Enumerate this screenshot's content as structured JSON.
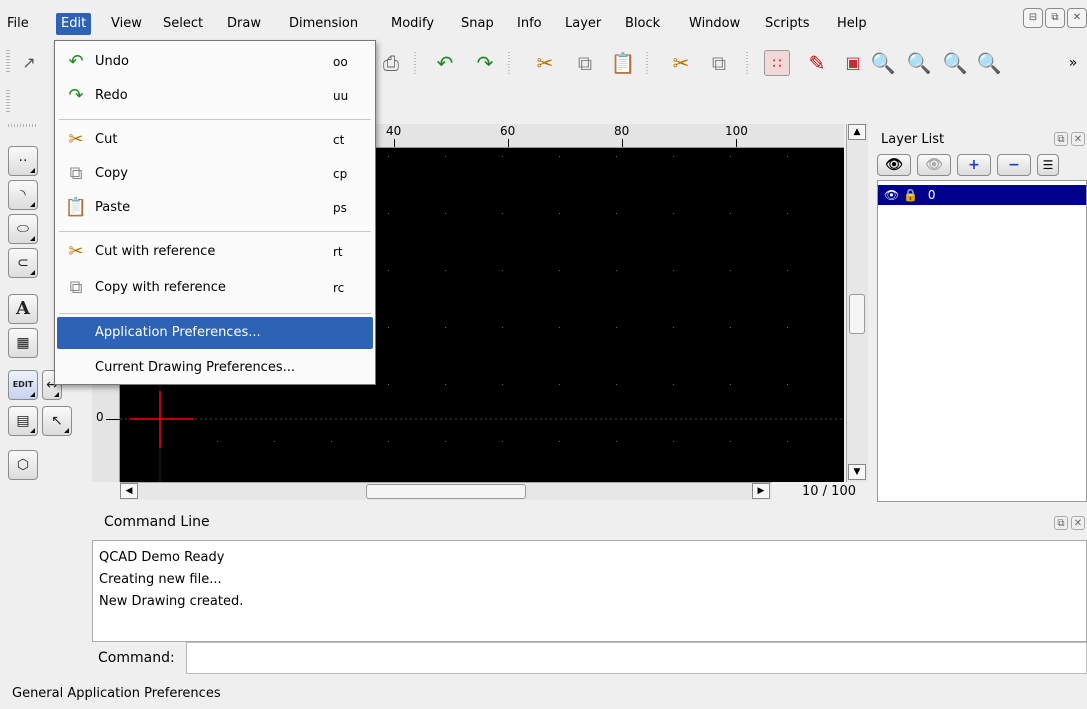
{
  "menubar": {
    "items": [
      "File",
      "Edit",
      "View",
      "Select",
      "Draw",
      "Dimension",
      "Modify",
      "Snap",
      "Info",
      "Layer",
      "Block",
      "Window",
      "Scripts",
      "Help"
    ],
    "active": "Edit"
  },
  "edit_menu": {
    "items": [
      {
        "label": "Undo",
        "shortcut": "oo",
        "icon": "undo-arrow-icon"
      },
      {
        "label": "Redo",
        "shortcut": "uu",
        "icon": "redo-arrow-icon"
      },
      {
        "label": "Cut",
        "shortcut": "ct",
        "icon": "scissors-icon"
      },
      {
        "label": "Copy",
        "shortcut": "cp",
        "icon": "copy-icon"
      },
      {
        "label": "Paste",
        "shortcut": "ps",
        "icon": "paste-icon"
      },
      {
        "label": "Cut with reference",
        "shortcut": "rt",
        "icon": "cut-with-reference-icon"
      },
      {
        "label": "Copy with reference",
        "shortcut": "rc",
        "icon": "copy-with-reference-icon"
      },
      {
        "label": "Application Preferences...",
        "shortcut": "",
        "icon": ""
      },
      {
        "label": "Current Drawing Preferences...",
        "shortcut": "",
        "icon": ""
      }
    ],
    "highlighted": "Application Preferences..."
  },
  "ruler": {
    "h_ticks": [
      "40",
      "60",
      "80",
      "100"
    ],
    "v_ticks": [
      "0"
    ]
  },
  "drawing": {
    "zoom_status": "10 / 100",
    "background": "#000000",
    "crosshair_color": "#ff0000"
  },
  "layer_panel": {
    "title": "Layer List",
    "layers": [
      {
        "name": "0",
        "visible": true,
        "locked": true
      }
    ],
    "selected_bg": "#00008b"
  },
  "command_line": {
    "title": "Command Line",
    "history": [
      "QCAD Demo Ready",
      "Creating new file...",
      "New Drawing created."
    ],
    "prompt_label": "Command:"
  },
  "status_bar": {
    "text": "General Application Preferences"
  },
  "colors": {
    "menu_highlight": "#2d62b4"
  }
}
